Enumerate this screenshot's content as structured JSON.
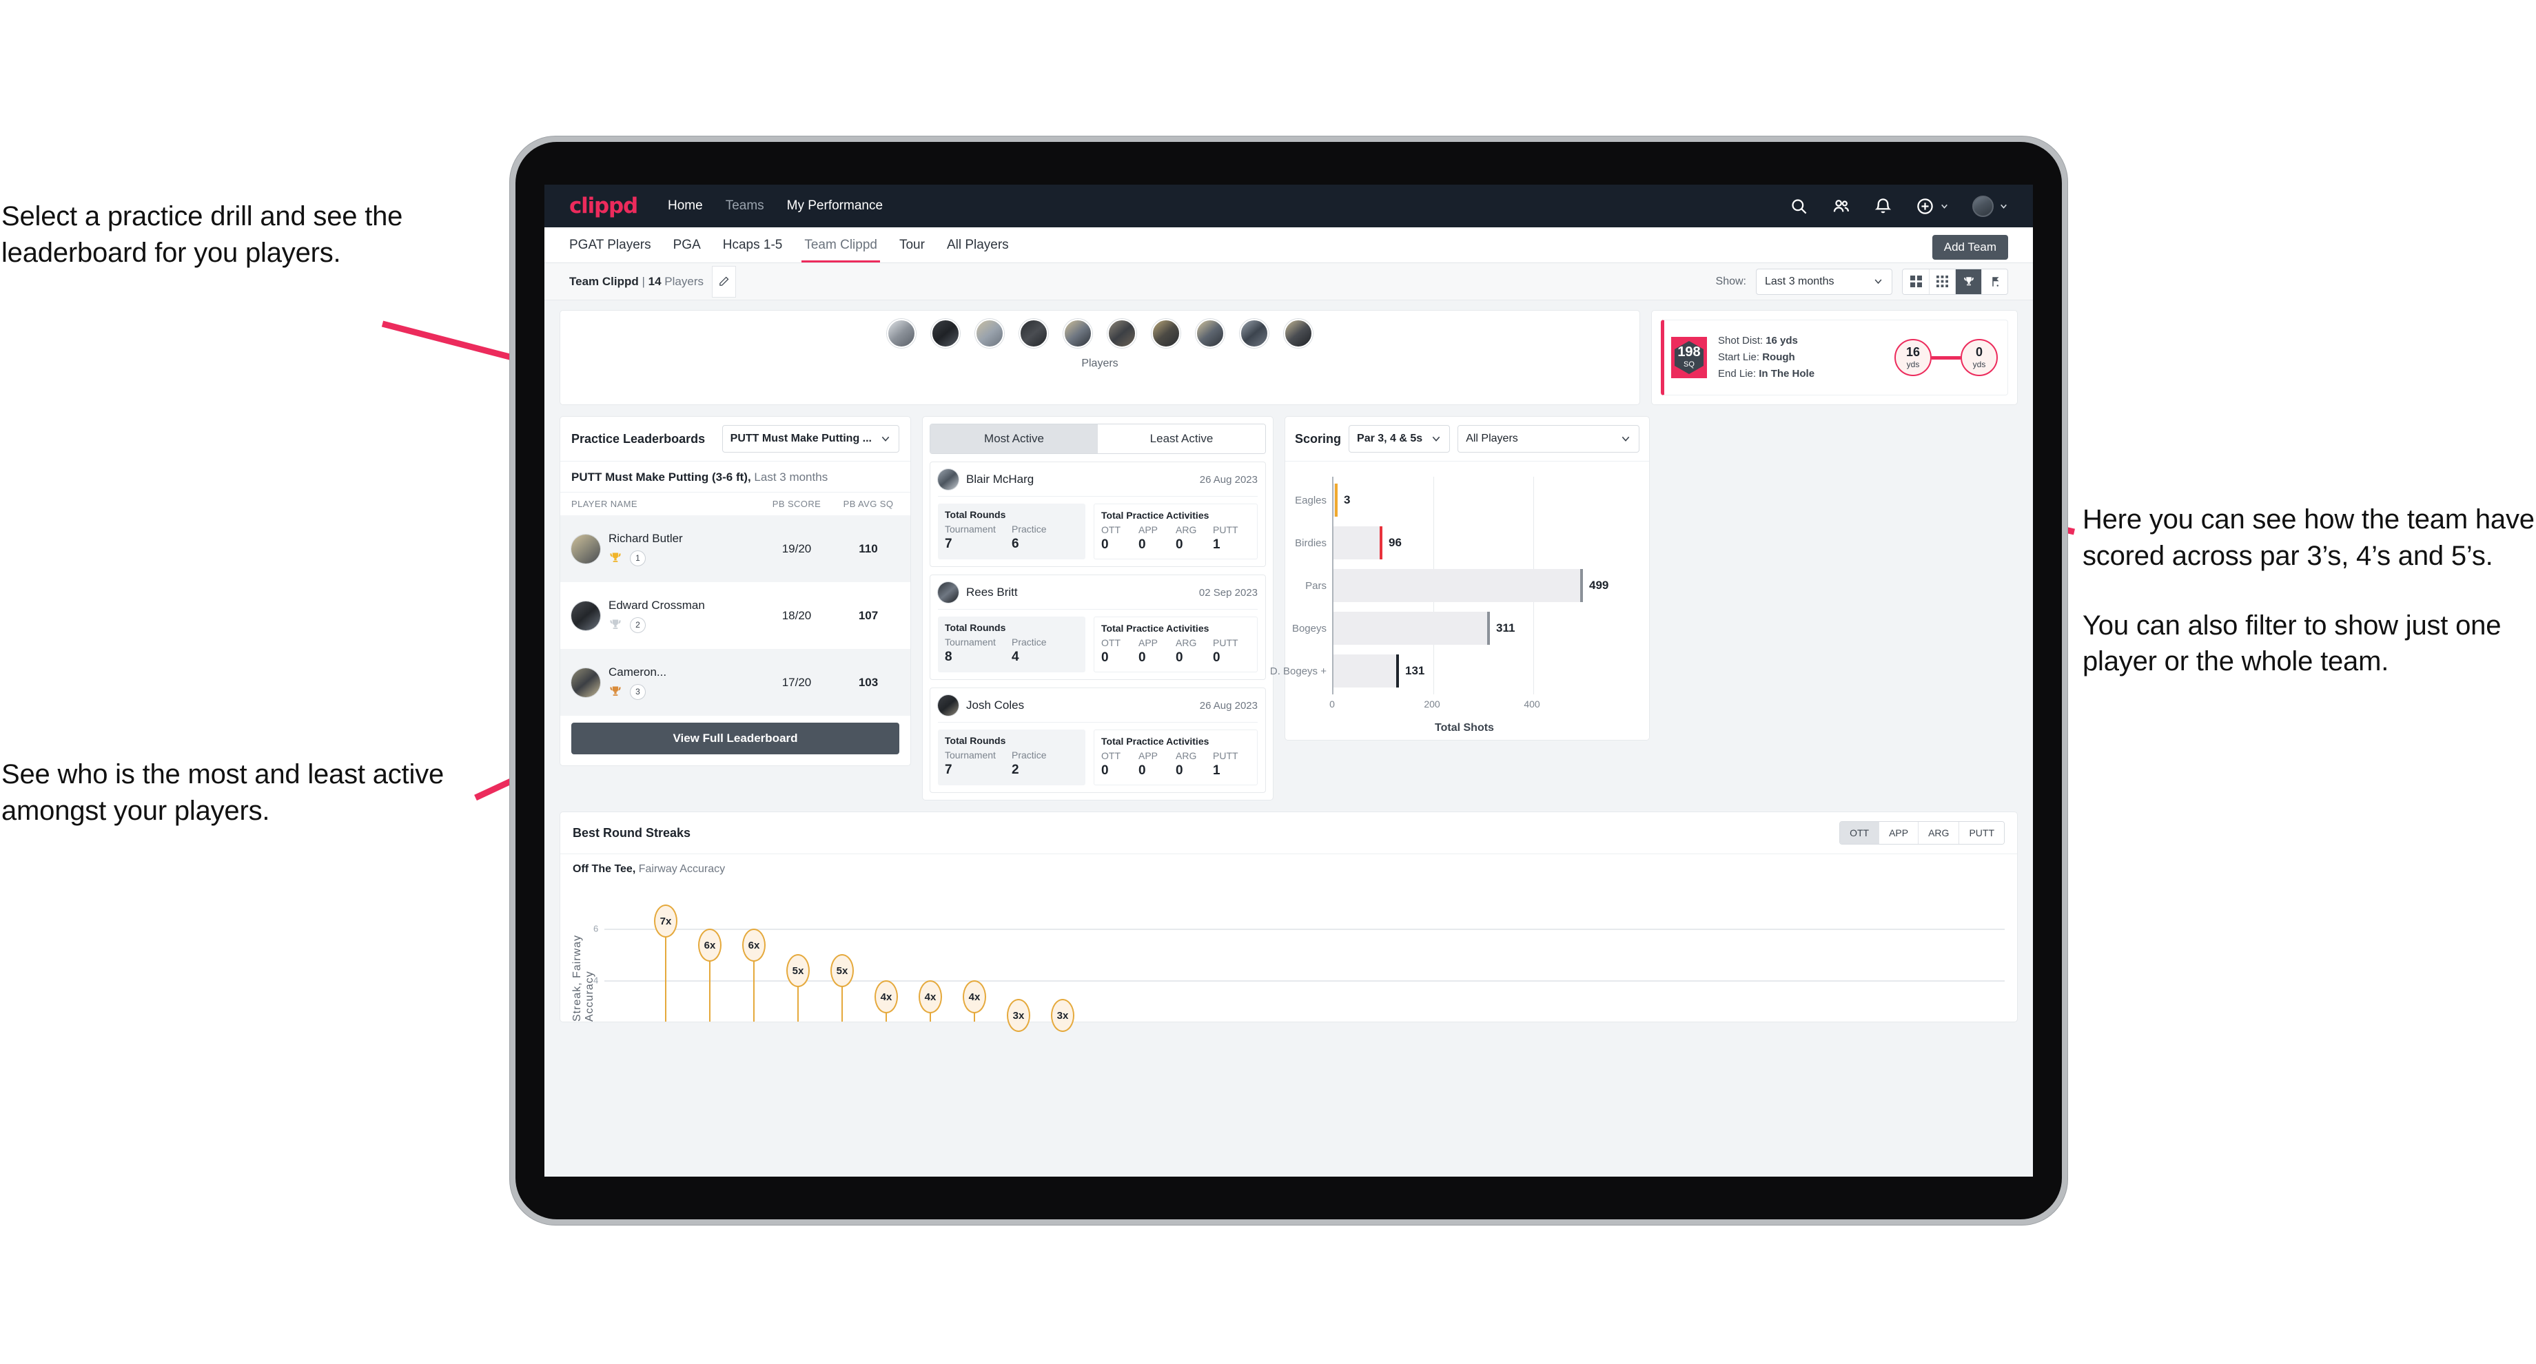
{
  "annotations": {
    "left_top": "Select a practice drill and see the leaderboard for you players.",
    "left_bottom": "See who is the most and least active amongst your players.",
    "right_1": "Here you can see how the team have scored across par 3’s, 4’s and 5’s.",
    "right_2": "You can also filter to show just one player or the whole team."
  },
  "navbar": {
    "logo": "clippd",
    "links": [
      {
        "label": "Home",
        "active": true
      },
      {
        "label": "Teams",
        "active": false
      },
      {
        "label": "My Performance",
        "active": true
      }
    ],
    "icons": [
      "search-icon",
      "people-icon",
      "bell-icon",
      "plus-circle-icon",
      "avatar"
    ]
  },
  "tabs": [
    {
      "label": "PGAT Players",
      "active": false
    },
    {
      "label": "PGA",
      "active": false
    },
    {
      "label": "Hcaps 1-5",
      "active": false
    },
    {
      "label": "Team Clippd",
      "active": true
    },
    {
      "label": "Tour",
      "active": false
    },
    {
      "label": "All Players",
      "active": false
    }
  ],
  "add_team_label": "Add Team",
  "subbar": {
    "team_name": "Team Clippd",
    "separator": "|",
    "player_count": "14",
    "players_word": "Players",
    "edit_icon": "pencil-icon",
    "show_label": "Show:",
    "show_value": "Last 3 months",
    "view_toggles": [
      {
        "icon": "grid-large-icon",
        "active": false
      },
      {
        "icon": "grid-small-icon",
        "active": false
      },
      {
        "icon": "trophy-icon",
        "active": true
      },
      {
        "icon": "flag-icon",
        "active": false
      }
    ]
  },
  "players_card": {
    "label": "Players",
    "avatar_count": 10
  },
  "shot_card": {
    "badge_value": "198",
    "badge_unit": "SQ",
    "lines": [
      {
        "label": "Shot Dist:",
        "value": "16 yds"
      },
      {
        "label": "Start Lie:",
        "value": "Rough"
      },
      {
        "label": "End Lie:",
        "value": "In The Hole"
      }
    ],
    "start_dist": "16",
    "start_unit": "yds",
    "end_dist": "0",
    "end_unit": "yds"
  },
  "leaderboard": {
    "title": "Practice Leaderboards",
    "drill_select": "PUTT Must Make Putting ...",
    "subtitle_bold": "PUTT Must Make Putting (3-6 ft),",
    "subtitle_muted": "Last 3 months",
    "columns": [
      "PLAYER NAME",
      "PB SCORE",
      "PB AVG SQ"
    ],
    "rows": [
      {
        "name": "Richard Butler",
        "rank": "1",
        "trophy": "gold",
        "pb_score": "19/20",
        "pb_avg_sq": "110"
      },
      {
        "name": "Edward Crossman",
        "rank": "2",
        "trophy": "silver",
        "pb_score": "18/20",
        "pb_avg_sq": "107"
      },
      {
        "name": "Cameron...",
        "rank": "3",
        "trophy": "bronze",
        "pb_score": "17/20",
        "pb_avg_sq": "103"
      }
    ],
    "button_label": "View Full Leaderboard"
  },
  "activity": {
    "tabs": [
      {
        "label": "Most Active",
        "active": true
      },
      {
        "label": "Least Active",
        "active": false
      }
    ],
    "rounds_title": "Total Rounds",
    "rounds_cols": [
      "Tournament",
      "Practice"
    ],
    "practice_title": "Total Practice Activities",
    "practice_cols": [
      "OTT",
      "APP",
      "ARG",
      "PUTT"
    ],
    "cards": [
      {
        "name": "Blair McHarg",
        "date": "26 Aug 2023",
        "tournament": "7",
        "practice": "6",
        "ott": "0",
        "app": "0",
        "arg": "0",
        "putt": "1"
      },
      {
        "name": "Rees Britt",
        "date": "02 Sep 2023",
        "tournament": "8",
        "practice": "4",
        "ott": "0",
        "app": "0",
        "arg": "0",
        "putt": "0"
      },
      {
        "name": "Josh Coles",
        "date": "26 Aug 2023",
        "tournament": "7",
        "practice": "2",
        "ott": "0",
        "app": "0",
        "arg": "0",
        "putt": "1"
      }
    ]
  },
  "scoring": {
    "title": "Scoring",
    "par_select": "Par 3, 4 & 5s",
    "player_select": "All Players"
  },
  "streaks": {
    "title": "Best Round Streaks",
    "segments": [
      {
        "label": "OTT",
        "active": true
      },
      {
        "label": "APP",
        "active": false
      },
      {
        "label": "ARG",
        "active": false
      },
      {
        "label": "PUTT",
        "active": false
      }
    ],
    "sub_bold": "Off The Tee,",
    "sub_muted": "Fairway Accuracy"
  },
  "colors": {
    "brand_pink": "#ec2b5c",
    "navy": "#18202b",
    "slate": "#4c555f",
    "amber": "#e5a93c",
    "panel_grey": "#f2f4f6"
  },
  "chart_data": [
    {
      "type": "bar",
      "title": "Scoring",
      "orientation": "horizontal",
      "categories": [
        "Eagles",
        "Birdies",
        "Pars",
        "Bogeys",
        "D. Bogeys +"
      ],
      "values": [
        3,
        96,
        499,
        311,
        131
      ],
      "cap_colors": [
        "#f0a92e",
        "#e8323c",
        "#8b9199",
        "#8b9199",
        "#1d232b"
      ],
      "xlabel": "Total Shots",
      "ylabel": "",
      "xlim": [
        0,
        530
      ],
      "xticks": [
        0,
        200,
        400
      ],
      "grid": true,
      "legend": "none"
    },
    {
      "type": "scatter",
      "title": "Best Round Streaks",
      "subtitle": "Off The Tee, Fairway Accuracy",
      "ylabel": "Streak, Fairway Accuracy",
      "values": [
        7,
        6,
        6,
        5,
        5,
        4,
        4,
        4,
        3,
        3
      ],
      "labels": [
        "7x",
        "6x",
        "6x",
        "5x",
        "5x",
        "4x",
        "4x",
        "4x",
        "3x",
        "3x"
      ],
      "yticks": [
        4,
        6
      ],
      "ylim": [
        0,
        8
      ],
      "grid": true,
      "legend": "none"
    }
  ]
}
